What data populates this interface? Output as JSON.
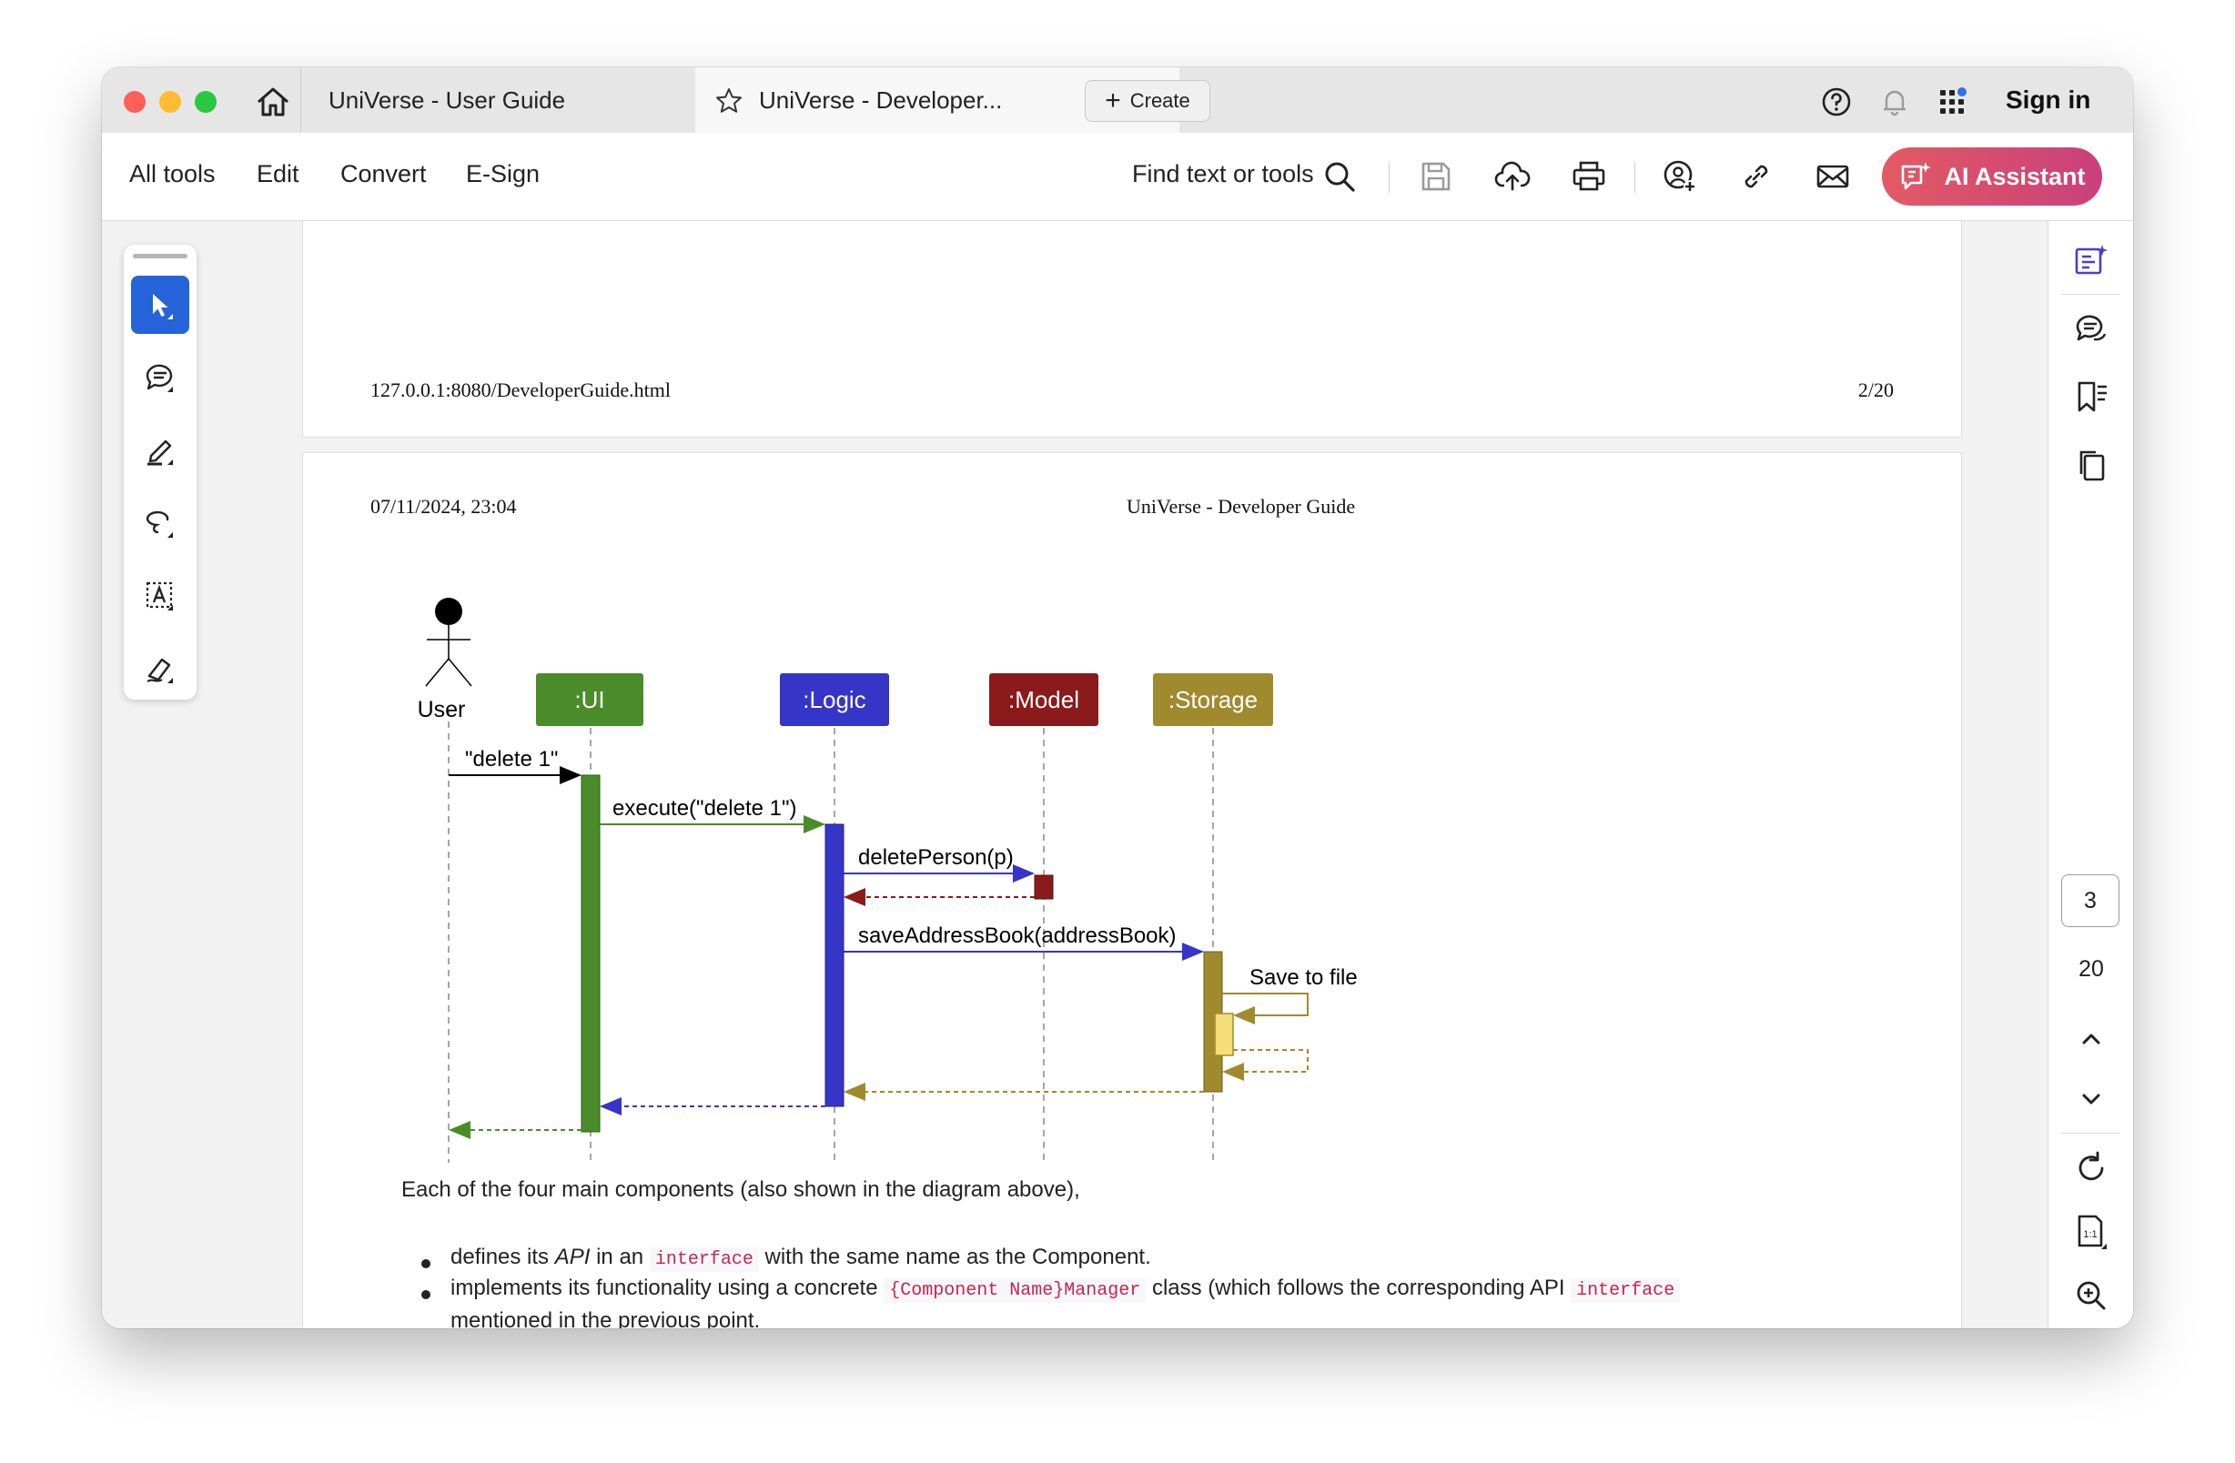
{
  "tabs": [
    {
      "label": "UniVerse - User Guide"
    },
    {
      "label": "UniVerse - Developer..."
    }
  ],
  "create_label": "Create",
  "signin_label": "Sign in",
  "menu": [
    "All tools",
    "Edit",
    "Convert",
    "E-Sign"
  ],
  "find_label": "Find text or tools",
  "ai_label": "AI Assistant",
  "page1": {
    "footer_url": "127.0.0.1:8080/DeveloperGuide.html",
    "footer_page": "2/20"
  },
  "page2": {
    "header_date": "07/11/2024, 23:04",
    "header_title": "UniVerse - Developer Guide"
  },
  "diagram": {
    "actor": "User",
    "participants": [
      ":UI",
      ":Logic",
      ":Model",
      ":Storage"
    ],
    "messages": [
      "\"delete 1\"",
      "execute(\"delete 1\")",
      "deletePerson(p)",
      "saveAddressBook(addressBook)",
      "Save to file"
    ],
    "colors": {
      "ui": "#4a8c2a",
      "logic": "#3535c8",
      "model": "#8b1a1a",
      "storage": "#a08a2e"
    }
  },
  "body": {
    "intro": "Each of the four main components (also shown in the diagram above),",
    "b1_pre": "defines its ",
    "b1_api": "API",
    "b1_mid": " in an ",
    "b1_code": "interface",
    "b1_post": " with the same name as the Component.",
    "b2_pre": "implements its functionality using a concrete ",
    "b2_code": "{Component Name}Manager",
    "b2_mid": " class (which follows the corresponding API ",
    "b2_code2": "interface",
    "b3": "mentioned in the previous point."
  },
  "nav": {
    "current_page": "3",
    "total_pages": "20"
  }
}
